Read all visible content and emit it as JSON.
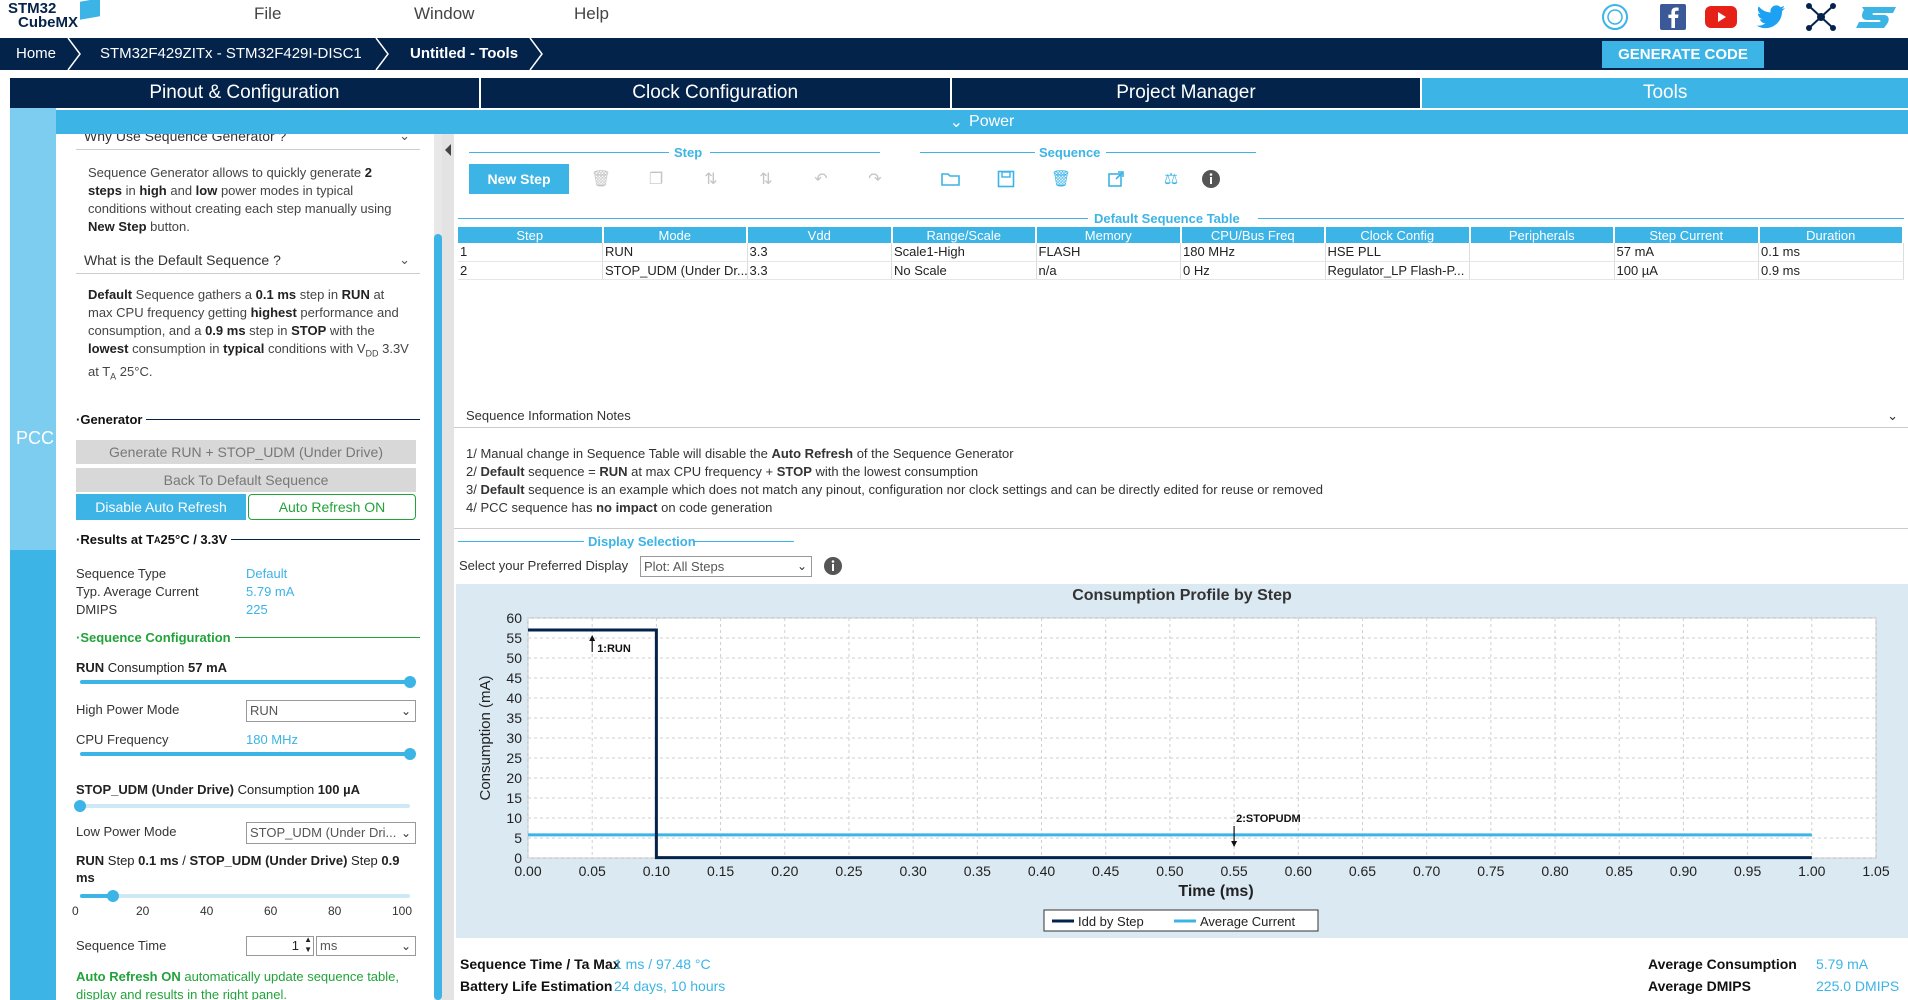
{
  "app": {
    "logo_line1": "STM32",
    "logo_line2": "CubeMX",
    "menu": [
      "File",
      "Window",
      "Help"
    ],
    "social_icons": [
      "anniversary-badge",
      "facebook",
      "youtube",
      "twitter",
      "network",
      "st-logo"
    ]
  },
  "breadcrumb": {
    "items": [
      "Home",
      "STM32F429ZITx  -  STM32F429I-DISC1",
      "Untitled - Tools"
    ],
    "generate_label": "GENERATE CODE"
  },
  "tabs": [
    {
      "label": "Pinout & Configuration",
      "active": false
    },
    {
      "label": "Clock Configuration",
      "active": false
    },
    {
      "label": "Project Manager",
      "active": false
    },
    {
      "label": "Tools",
      "active": true
    }
  ],
  "power_bar": {
    "label": "Power"
  },
  "pcc_label": "PCC",
  "left": {
    "acc1": "Why Use Sequence Generator ?",
    "acc2": "What is the Default Sequence ?",
    "generator_title": "Generator",
    "gen_btn1": "Generate RUN + STOP_UDM (Under Drive)",
    "gen_btn2": "Back To Default Sequence",
    "disable_btn": "Disable Auto Refresh",
    "autorefresh_btn": "Auto Refresh ON",
    "results_title_pre": "Results at T",
    "results_title_sub": "A",
    "results_title_post": " 25°C / 3.3V",
    "seq_type_label": "Sequence Type",
    "seq_type_value": "Default",
    "avg_current_label": "Typ. Average Current",
    "avg_current_value": "5.79 mA",
    "dmips_label": "DMIPS",
    "dmips_value": "225",
    "seqconf_title": "Sequence Configuration",
    "run_cons_pre": "RUN",
    "run_cons_mid": " Consumption ",
    "run_cons_val": "57 mA",
    "run_slider_fraction": 1.0,
    "hp_mode_label": "High Power Mode",
    "hp_mode_value": "RUN",
    "cpu_freq_label": "CPU Frequency",
    "cpu_freq_value": "180 MHz",
    "cpu_slider_fraction": 1.0,
    "stop_cons_pre": "STOP_UDM (Under Drive)",
    "stop_cons_mid": " Consumption ",
    "stop_cons_val": "100 µA",
    "stop_slider_fraction": 0.0,
    "lp_mode_label": "Low Power Mode",
    "lp_mode_value": "STOP_UDM (Under Dri...",
    "step_line_a": "RUN",
    "step_line_b": " Step ",
    "step_line_c": "0.1 ms",
    "step_line_d": " / ",
    "step_line_e": "STOP_UDM (Under Drive)",
    "step_line_f": " Step ",
    "step_line_g": "0.9",
    "step_line_h": "ms",
    "step_slider_fraction": 0.1,
    "step_ticks": [
      "0",
      "20",
      "40",
      "60",
      "80",
      "100"
    ],
    "seq_time_label": "Sequence Time",
    "seq_time_value": "1",
    "seq_time_unit": "ms",
    "footer_bold": "Auto Refresh ON",
    "footer_text": " automatically update sequence table,",
    "footer_text2": "display and results in the right panel."
  },
  "toolbar": {
    "step_title": "Step",
    "sequence_title": "Sequence",
    "new_step": "New Step"
  },
  "table": {
    "title": "Default Sequence Table",
    "headers": [
      "Step",
      "Mode",
      "Vdd",
      "Range/Scale",
      "Memory",
      "CPU/Bus Freq",
      "Clock Config",
      "Peripherals",
      "Step Current",
      "Duration"
    ],
    "rows": [
      [
        "1",
        "RUN",
        "3.3",
        "Scale1-High",
        "FLASH",
        "180 MHz",
        "HSE PLL",
        "",
        "57 mA",
        "0.1 ms"
      ],
      [
        "2",
        "STOP_UDM (Under Dr...",
        "3.3",
        "No Scale",
        "n/a",
        "0 Hz",
        "Regulator_LP Flash-P...",
        "",
        "100 µA",
        "0.9 ms"
      ]
    ]
  },
  "notes": {
    "title": "Sequence Information Notes",
    "n1_a": "1/ Manual change in Sequence Table will disable the ",
    "n1_b": "Auto Refresh",
    "n1_c": " of the Sequence Generator",
    "n2_a": "2/ ",
    "n2_b": "Default",
    "n2_c": " sequence = ",
    "n2_d": "RUN",
    "n2_e": " at max CPU frequency + ",
    "n2_f": "STOP",
    "n2_g": " with the lowest consumption",
    "n3_a": "3/ ",
    "n3_b": "Default",
    "n3_c": " sequence is an example which does not match any pinout, configuration nor clock settings and can be directly edited for reuse or removed",
    "n4_a": "4/ PCC sequence has ",
    "n4_b": "no impact",
    "n4_c": " on code generation"
  },
  "display": {
    "title": "Display Selection",
    "prompt": "Select your Preferred Display",
    "select_value": "Plot: All Steps"
  },
  "chart_data": {
    "type": "line",
    "title": "Consumption Profile by Step",
    "xlabel": "Time (ms)",
    "ylabel": "Consumption (mA)",
    "xlim": [
      0.0,
      1.05
    ],
    "ylim": [
      0,
      60
    ],
    "xticks": [
      "0.00",
      "0.05",
      "0.10",
      "0.15",
      "0.20",
      "0.25",
      "0.30",
      "0.35",
      "0.40",
      "0.45",
      "0.50",
      "0.55",
      "0.60",
      "0.65",
      "0.70",
      "0.75",
      "0.80",
      "0.85",
      "0.90",
      "0.95",
      "1.00",
      "1.05"
    ],
    "yticks": [
      "0",
      "5",
      "10",
      "15",
      "20",
      "25",
      "30",
      "35",
      "40",
      "45",
      "50",
      "55",
      "60"
    ],
    "grid": true,
    "legend_placement": "bottom",
    "series": [
      {
        "name": "Idd by Step",
        "color": "#03234b",
        "x": [
          0.0,
          0.1,
          0.1,
          1.0
        ],
        "y": [
          57,
          57,
          0.1,
          0.1
        ]
      },
      {
        "name": "Average Current",
        "color": "#3cb4e6",
        "x": [
          0.0,
          1.0
        ],
        "y": [
          5.79,
          5.79
        ]
      }
    ],
    "annotations": [
      {
        "text": "1:RUN",
        "x": 0.05,
        "y": 57
      },
      {
        "text": "2:STOPUDM",
        "x": 0.55,
        "y": 5
      }
    ]
  },
  "footer": {
    "seqtime_label": "Sequence Time / Ta Max",
    "seqtime_value": "1 ms / 97.48 °C",
    "battery_label": "Battery Life Estimation",
    "battery_value": "24 days, 10 hours",
    "avg_cons_label": "Average Consumption",
    "avg_cons_value": "5.79 mA",
    "avg_dmips_label": "Average DMIPS",
    "avg_dmips_value": "225.0 DMIPS"
  },
  "colors": {
    "navy": "#03234b",
    "accent": "#3cb4e6",
    "green": "#22a33a"
  }
}
